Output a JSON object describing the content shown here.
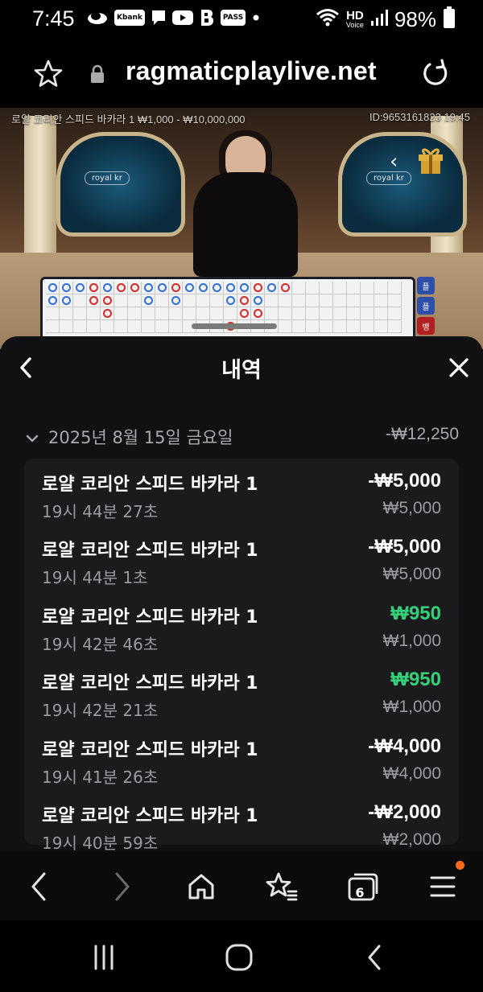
{
  "status_bar": {
    "time": "7:45",
    "notification_icons": [
      "cloud-icon",
      "kbank-icon",
      "message-icon",
      "youtube-icon",
      "b-app-icon",
      "pass-icon",
      "dot-icon"
    ],
    "kbank_label": "Kbank",
    "pass_label": "PASS",
    "hd_label": "HD",
    "voice_label": "Voice",
    "battery": "98%"
  },
  "browser": {
    "url": "ragmaticplaylive.net"
  },
  "game": {
    "table_info": "로얄 코리안 스피드 바카라 1  ₩1,000 - ₩10,000,000",
    "round_info": "ID:9653161823  19:45",
    "screen_label": "royal kr",
    "side_tabs": [
      "플",
      "플",
      "뱅"
    ],
    "roadmap_rows": [
      "bbbrbrrbbrbbbbbrbr",
      "bb.rr..b.b...brb..",
      "....r.........rr..",
      ".............r...."
    ]
  },
  "panel": {
    "title": "내역",
    "date": "2025년 8월 15일 금요일",
    "date_total": "-₩12,250",
    "rows": [
      {
        "name": "로얄 코리안 스피드 바카라 1",
        "time": "19시 44분 27초",
        "amount": "-₩5,000",
        "stake": "₩5,000",
        "result": "loss"
      },
      {
        "name": "로얄 코리안 스피드 바카라 1",
        "time": "19시 44분 1초",
        "amount": "-₩5,000",
        "stake": "₩5,000",
        "result": "loss"
      },
      {
        "name": "로얄 코리안 스피드 바카라 1",
        "time": "19시 42분 46초",
        "amount": "₩950",
        "stake": "₩1,000",
        "result": "win"
      },
      {
        "name": "로얄 코리안 스피드 바카라 1",
        "time": "19시 42분 21초",
        "amount": "₩950",
        "stake": "₩1,000",
        "result": "win"
      },
      {
        "name": "로얄 코리안 스피드 바카라 1",
        "time": "19시 41분 26초",
        "amount": "-₩4,000",
        "stake": "₩4,000",
        "result": "loss"
      },
      {
        "name": "로얄 코리안 스피드 바카라 1",
        "time": "19시 40분 59초",
        "amount": "-₩2,000",
        "stake": "₩2,000",
        "result": "loss"
      }
    ]
  },
  "toolbar": {
    "tabs_count": "6"
  },
  "colors": {
    "win": "#35d07a",
    "loss": "#ffffff",
    "notification": "#ff6a1a",
    "banker_red": "#d62a2a",
    "player_blue": "#2e6fd8"
  }
}
